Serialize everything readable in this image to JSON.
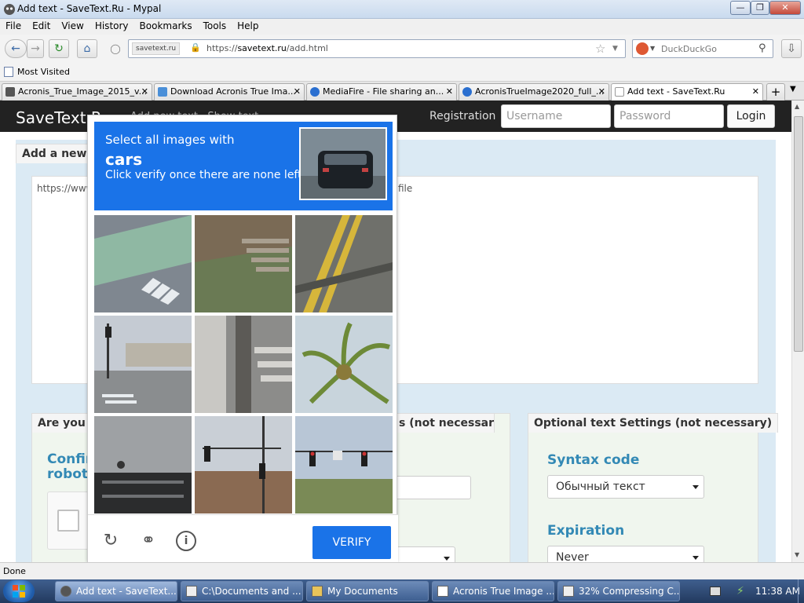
{
  "window": {
    "title": "Add text - SaveText.Ru - Mypal"
  },
  "menu": [
    "File",
    "Edit",
    "View",
    "History",
    "Bookmarks",
    "Tools",
    "Help"
  ],
  "nav": {
    "site_badge": "savetext.ru",
    "url_scheme": "https://",
    "url_host": "savetext.ru",
    "url_path": "/add.html",
    "search_placeholder": "DuckDuckGo"
  },
  "bookmarks": {
    "most_visited": "Most Visited"
  },
  "tabs": [
    {
      "label": "Acronis_True_Image_2015_v..."
    },
    {
      "label": "Download Acronis True Ima..."
    },
    {
      "label": "MediaFire - File sharing an..."
    },
    {
      "label": "AcronisTrueImage2020_full_..."
    },
    {
      "label": "Add text - SaveText.Ru"
    }
  ],
  "site": {
    "logo": "SaveText.R",
    "nav_hint": "Add new text  ·  Show text",
    "registration": "Registration",
    "username_placeholder": "Username",
    "password_placeholder": "Password",
    "login": "Login",
    "add_new_tab": "Add a new te",
    "textarea_left": "https://www",
    "textarea_right": "file",
    "robot_tab": "Are you a",
    "confirm_label": "Confirm\nrobot:",
    "settings_tab_mid": "s (not necessary)",
    "settings_tab_right": "Optional text Settings (not necessary)",
    "syntax_label": "Syntax code",
    "syntax_value": "Обычный текст",
    "expiration_label": "Expiration",
    "expiration_value": "Never"
  },
  "captcha": {
    "line1": "Select all images with",
    "keyword": "cars",
    "line3": "Click verify once there are none left",
    "verify": "VERIFY"
  },
  "status": "Done",
  "taskbar": {
    "items": [
      "Add text - SaveText....",
      "C:\\Documents and ...",
      "My Documents",
      "Acronis True Image ...",
      "32% Compressing C..."
    ],
    "clock": "11:38 AM"
  },
  "colors": {
    "captcha_blue": "#1a73e8",
    "site_accent": "#3389b5",
    "site_header": "#222222"
  }
}
